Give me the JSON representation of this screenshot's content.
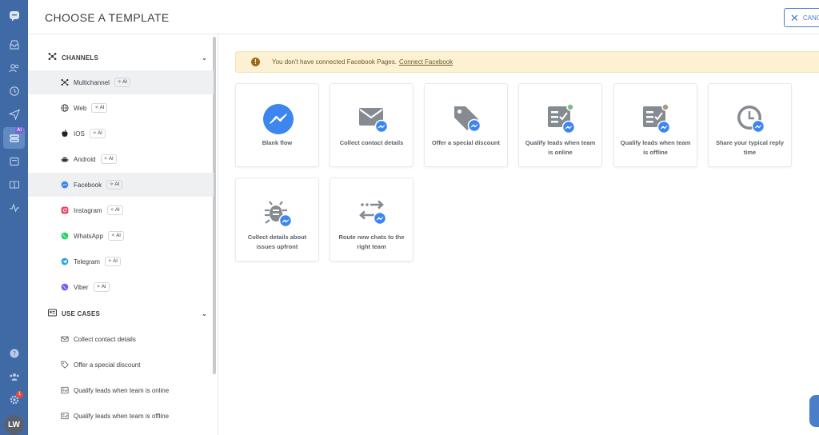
{
  "header": {
    "title": "CHOOSE A TEMPLATE",
    "cancel_label": "CANC"
  },
  "rail": {
    "avatar_initials": "LW",
    "ai_badge": "AI",
    "notification_count": "1"
  },
  "sidebar": {
    "channels_header": "CHANNELS",
    "use_cases_header": "USE CASES",
    "ai_badge": "AI",
    "channels": [
      {
        "label": "Multichannel",
        "icon": "multichannel-icon"
      },
      {
        "label": "Web",
        "icon": "globe-icon"
      },
      {
        "label": "IOS",
        "icon": "apple-icon"
      },
      {
        "label": "Android",
        "icon": "android-icon"
      },
      {
        "label": "Facebook",
        "icon": "messenger-icon"
      },
      {
        "label": "Instagram",
        "icon": "instagram-icon"
      },
      {
        "label": "WhatsApp",
        "icon": "whatsapp-icon"
      },
      {
        "label": "Telegram",
        "icon": "telegram-icon"
      },
      {
        "label": "Viber",
        "icon": "viber-icon"
      }
    ],
    "use_cases": [
      {
        "label": "Collect contact details",
        "icon": "envelope-icon"
      },
      {
        "label": "Offer a special discount",
        "icon": "tag-icon"
      },
      {
        "label": "Qualify leads when team is online",
        "icon": "qualify-online-icon"
      },
      {
        "label": "Qualify leads when team is offline",
        "icon": "qualify-offline-icon"
      }
    ]
  },
  "main": {
    "warning": {
      "text": "You don't have connected Facebook Pages.",
      "link": "Connect Facebook"
    },
    "templates": [
      {
        "label": "Blank flow",
        "icon": "messenger-circle-icon"
      },
      {
        "label": "Collect contact details",
        "icon": "envelope-icon"
      },
      {
        "label": "Offer a special discount",
        "icon": "tag-icon"
      },
      {
        "label": "Qualify leads when team is online",
        "icon": "qualify-online-icon"
      },
      {
        "label": "Qualify leads when team is offline",
        "icon": "qualify-offline-icon"
      },
      {
        "label": "Share your typical reply time",
        "icon": "clock-icon"
      },
      {
        "label": "Collect details about issues upfront",
        "icon": "bug-icon"
      },
      {
        "label": "Route new chats to the right team",
        "icon": "route-arrows-icon"
      }
    ]
  },
  "colors": {
    "rail": "#3f6aa6",
    "accent": "#4a7ec8",
    "messenger": "#3d86f0",
    "warning_bg": "#fdf1d4",
    "icon_gray": "#868b92"
  }
}
